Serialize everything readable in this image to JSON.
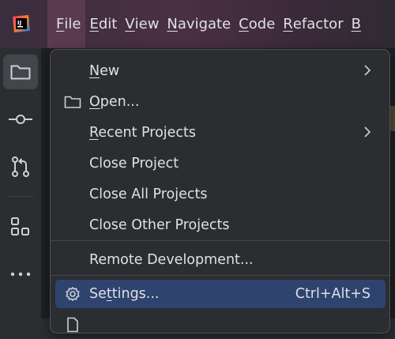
{
  "menubar": {
    "items": [
      {
        "mn": "F",
        "rest": "ile"
      },
      {
        "mn": "E",
        "rest": "dit"
      },
      {
        "mn": "V",
        "rest": "iew"
      },
      {
        "mn": "N",
        "rest": "avigate"
      },
      {
        "mn": "C",
        "rest": "ode"
      },
      {
        "mn": "R",
        "rest": "efactor"
      },
      {
        "mn": "B",
        "rest": ""
      }
    ]
  },
  "file_menu": {
    "new": {
      "mn": "N",
      "rest": "ew"
    },
    "open": {
      "mn": "O",
      "rest": "pen..."
    },
    "recent": {
      "mn": "R",
      "rest": "ecent Projects"
    },
    "close_project": "Close Project",
    "close_all": "Close All Projects",
    "close_other": "Close Other Projects",
    "remote": "Remote Development...",
    "settings": {
      "pre": "Se",
      "mn": "t",
      "rest": "tings...",
      "shortcut": "Ctrl+Alt+S"
    }
  },
  "colors": {
    "menu_bg": "#2b2d30",
    "selection": "#2e436e",
    "text": "#dfe1e5",
    "titlebar_accent": "#4a3045"
  },
  "icons": {
    "app": "intellij-logo",
    "project": "folder-icon",
    "commit": "commit-icon",
    "pull_requests": "pull-request-icon",
    "structure": "structure-icon",
    "more": "more-icon",
    "open": "folder-open-icon",
    "settings": "gear-icon",
    "submenu": "chevron-right-icon"
  }
}
